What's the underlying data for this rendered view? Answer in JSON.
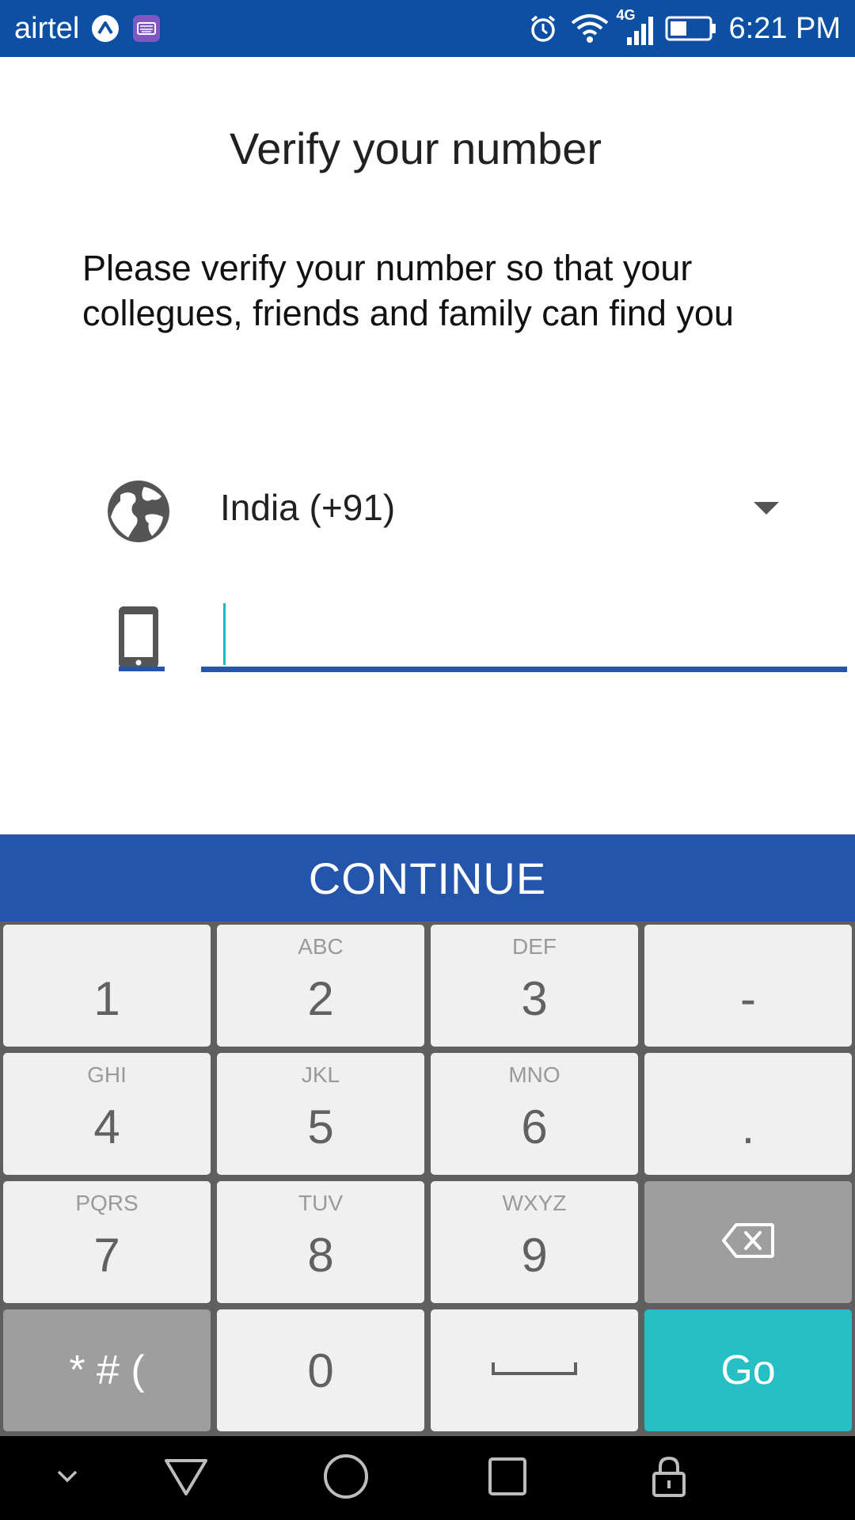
{
  "status_bar": {
    "carrier": "airtel",
    "network_type": "4G",
    "time": "6:21 PM",
    "icons": [
      "arrow-up-circle-icon",
      "keyboard-icon",
      "alarm-icon",
      "wifi-icon",
      "signal-icon",
      "battery-icon"
    ]
  },
  "header": {
    "title": "Verify your number"
  },
  "main": {
    "description": "Please verify your number so that your collegues, friends and family can find you",
    "country": {
      "selected": "India (+91)",
      "icon": "globe-icon"
    },
    "phone": {
      "value": "",
      "placeholder": "",
      "icon": "phone-icon"
    },
    "continue_label": "CONTINUE"
  },
  "keyboard": {
    "rows": [
      [
        {
          "main": "1",
          "sub": ""
        },
        {
          "main": "2",
          "sub": "ABC"
        },
        {
          "main": "3",
          "sub": "DEF"
        },
        {
          "main": "-",
          "sub": ""
        }
      ],
      [
        {
          "main": "4",
          "sub": "GHI"
        },
        {
          "main": "5",
          "sub": "JKL"
        },
        {
          "main": "6",
          "sub": "MNO"
        },
        {
          "main": ".",
          "sub": ""
        }
      ],
      [
        {
          "main": "7",
          "sub": "PQRS"
        },
        {
          "main": "8",
          "sub": "TUV"
        },
        {
          "main": "9",
          "sub": "WXYZ"
        },
        {
          "main": "",
          "sub": "",
          "icon": "backspace-icon"
        }
      ],
      [
        {
          "main": "* # (",
          "sub": ""
        },
        {
          "main": "0",
          "sub": ""
        },
        {
          "main": "",
          "sub": "",
          "icon": "space-icon"
        },
        {
          "main": "Go",
          "sub": ""
        }
      ]
    ]
  },
  "nav_bar": {
    "icons": [
      "hide-keyboard-icon",
      "back-icon",
      "home-icon",
      "recents-icon",
      "lock-icon"
    ]
  },
  "colors": {
    "status_bar": "#0d4fa3",
    "primary": "#2455ab",
    "accent": "#26bfc6",
    "key_light": "#f0f0f0",
    "key_dark": "#9e9e9e"
  }
}
